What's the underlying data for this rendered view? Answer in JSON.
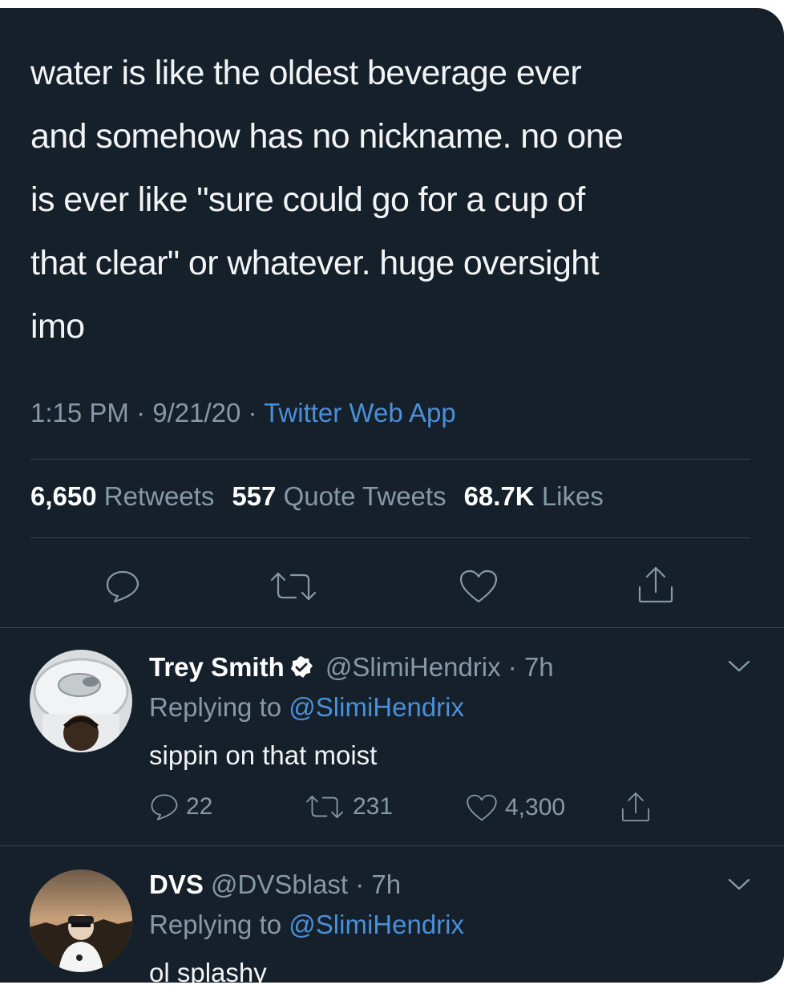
{
  "tweet": {
    "text": "water is like the oldest beverage ever\nand somehow has no nickname. no one\nis ever like \"sure could go for a cup of\nthat clear\" or whatever. huge oversight\nimo",
    "time": "1:15 PM",
    "date": "9/21/20",
    "source": "Twitter Web App",
    "separator": " · ",
    "stats": {
      "retweets_count": "6,650",
      "retweets_label": "Retweets",
      "quotes_count": "557",
      "quotes_label": "Quote Tweets",
      "likes_count": "68.7K",
      "likes_label": "Likes"
    }
  },
  "replies": [
    {
      "name": "Trey Smith",
      "verified": true,
      "handle": "@SlimiHendrix",
      "age": "· 7h",
      "replying_prefix": "Replying to",
      "replying_to": "@SlimiHendrix",
      "text": "sippin on that moist",
      "reply_count": "22",
      "retweet_count": "231",
      "like_count": "4,300"
    },
    {
      "name": "DVS",
      "verified": false,
      "handle": "@DVSblast",
      "age": "· 7h",
      "replying_prefix": "Replying to",
      "replying_to": "@SlimiHendrix",
      "text": "ol splashy"
    }
  ],
  "icons": {
    "reply": "speech-bubble-icon",
    "retweet": "retweet-arrows-icon",
    "like": "heart-icon",
    "share": "share-upload-icon",
    "more": "chevron-down-icon",
    "verified": "verified-badge-icon"
  },
  "colors": {
    "background": "#15202b",
    "text": "#ffffff",
    "muted": "#8899a6",
    "link": "#4a8fd8",
    "divider": "#38444d"
  }
}
